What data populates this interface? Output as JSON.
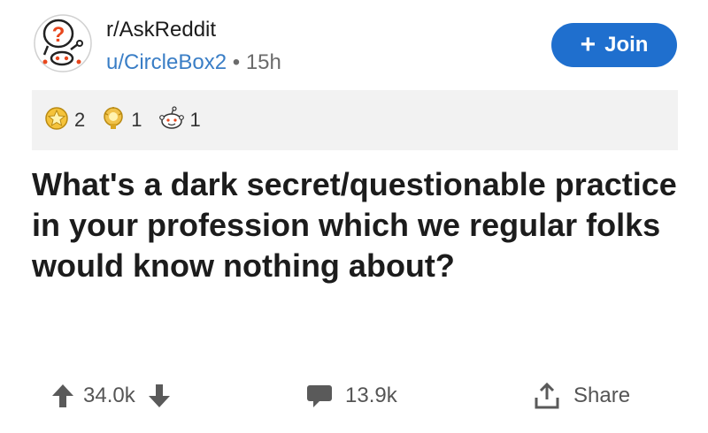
{
  "post": {
    "subreddit": "r/AskReddit",
    "author": "u/CircleBox2",
    "separator": "•",
    "age": "15h",
    "join_label": "Join",
    "awards": [
      {
        "icon": "star-award-icon",
        "count": "2"
      },
      {
        "icon": "trophy-award-icon",
        "count": "1"
      },
      {
        "icon": "snoo-award-icon",
        "count": "1"
      }
    ],
    "title": "What's a dark secret/questionable practice in your profession which we regular folks would know nothing about?",
    "votes": "34.0k",
    "comments": "13.9k",
    "share_label": "Share"
  },
  "colors": {
    "join_bg": "#1f6fce",
    "author_link": "#3a7ec6",
    "award_bar_bg": "#f2f2f2"
  }
}
